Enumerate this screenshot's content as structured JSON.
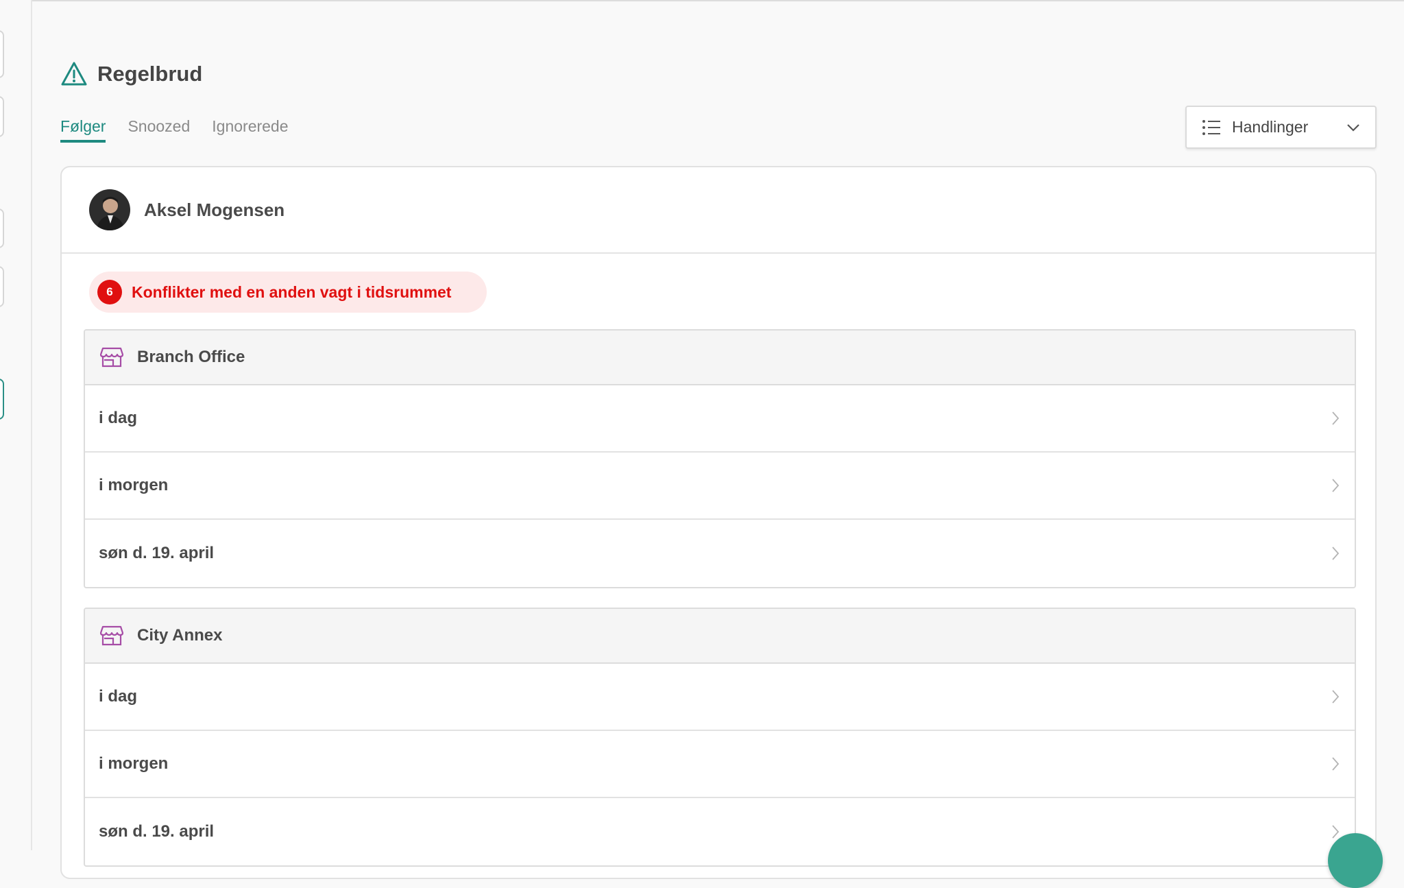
{
  "page": {
    "title": "Regelbrud",
    "tabs": [
      {
        "label": "Følger",
        "active": true
      },
      {
        "label": "Snoozed",
        "active": false
      },
      {
        "label": "Ignorerede",
        "active": false
      }
    ],
    "actions_label": "Handlinger"
  },
  "person": {
    "name": "Aksel Mogensen"
  },
  "conflict": {
    "count": "6",
    "text": "Konflikter med en anden vagt i tidsrummet"
  },
  "groups": [
    {
      "name": "Branch Office",
      "rows": [
        "i dag",
        "i morgen",
        "søn d. 19. april"
      ]
    },
    {
      "name": "City Annex",
      "rows": [
        "i dag",
        "i morgen",
        "søn d. 19. april"
      ]
    }
  ],
  "colors": {
    "accent": "#1e8a80",
    "danger": "#e01010",
    "danger_bg": "#fde9e9",
    "store_icon": "#a64ca6"
  }
}
